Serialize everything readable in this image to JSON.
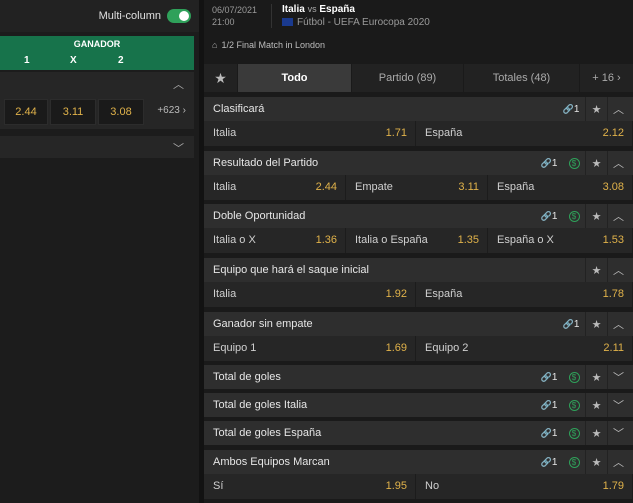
{
  "left": {
    "multicolumn_label": "Multi-column",
    "ganador": "GANADOR",
    "cols": [
      "1",
      "X",
      "2"
    ],
    "odds": [
      "2.44",
      "3.11",
      "3.08"
    ],
    "more": "+623"
  },
  "match": {
    "date": "06/07/2021",
    "time": "21:00",
    "home": "Italia",
    "vs": "vs",
    "away": "España",
    "competition": "Fútbol - UEFA Eurocopa 2020",
    "info": "1/2 Final Match in London"
  },
  "tabs": [
    {
      "label": "Todo"
    },
    {
      "label": "Partido (89)"
    },
    {
      "label": "Totales (48)"
    },
    {
      "label": "+ 16"
    }
  ],
  "markets": [
    {
      "title": "Clasificará",
      "link": "1",
      "cash": false,
      "open": true,
      "sels": [
        {
          "n": "Italia",
          "o": "1.71"
        },
        {
          "n": "España",
          "o": "2.12"
        }
      ]
    },
    {
      "title": "Resultado del Partido",
      "link": "1",
      "cash": true,
      "open": true,
      "sels": [
        {
          "n": "Italia",
          "o": "2.44"
        },
        {
          "n": "Empate",
          "o": "3.11"
        },
        {
          "n": "España",
          "o": "3.08"
        }
      ]
    },
    {
      "title": "Doble Oportunidad",
      "link": "1",
      "cash": true,
      "open": true,
      "sels": [
        {
          "n": "Italia o X",
          "o": "1.36"
        },
        {
          "n": "Italia o España",
          "o": "1.35"
        },
        {
          "n": "España o X",
          "o": "1.53"
        }
      ]
    },
    {
      "title": "Equipo que hará el saque inicial",
      "link": "",
      "cash": false,
      "open": true,
      "sels": [
        {
          "n": "Italia",
          "o": "1.92"
        },
        {
          "n": "España",
          "o": "1.78"
        }
      ]
    },
    {
      "title": "Ganador sin empate",
      "link": "1",
      "cash": false,
      "open": true,
      "sels": [
        {
          "n": "Equipo 1",
          "o": "1.69"
        },
        {
          "n": "Equipo 2",
          "o": "2.11"
        }
      ]
    },
    {
      "title": "Total de goles",
      "link": "1",
      "cash": true,
      "open": false,
      "sels": []
    },
    {
      "title": "Total de goles Italia",
      "link": "1",
      "cash": true,
      "open": false,
      "sels": []
    },
    {
      "title": "Total de goles España",
      "link": "1",
      "cash": true,
      "open": false,
      "sels": []
    },
    {
      "title": "Ambos Equipos Marcan",
      "link": "1",
      "cash": true,
      "open": true,
      "sels": [
        {
          "n": "Sí",
          "o": "1.95"
        },
        {
          "n": "No",
          "o": "1.79"
        }
      ]
    }
  ],
  "icons": {
    "link": "link-icon",
    "cash": "cashout-icon",
    "star": "star-icon",
    "up": "chevron-up-icon",
    "down": "chevron-down-icon"
  }
}
